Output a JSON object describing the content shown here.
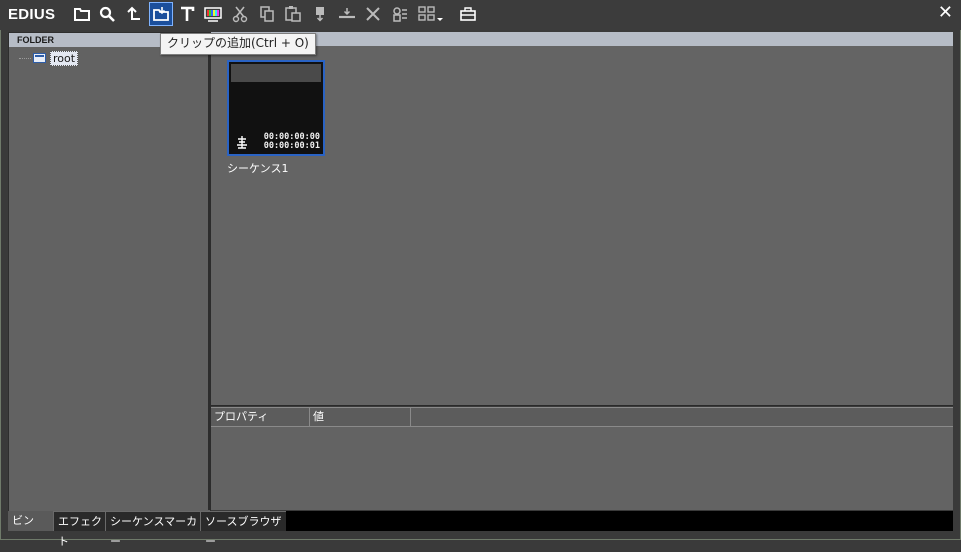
{
  "app": {
    "title": "EDIUS",
    "close_label": "✕"
  },
  "toolbar": {
    "tooltip": "クリップの追加(Ctrl + O)",
    "buttons": [
      "new-folder",
      "search",
      "up-level",
      "add-clip",
      "title",
      "color-bar",
      "cut",
      "copy",
      "paste",
      "add-to-timeline",
      "insert",
      "delete",
      "properties",
      "view-mode",
      "bin-menu"
    ],
    "active_button": "add-clip",
    "accent_color": "#1b4f9c"
  },
  "folder": {
    "header": "FOLDER",
    "tree": [
      {
        "label": "root",
        "icon": "folder-icon"
      }
    ]
  },
  "clips": [
    {
      "name": "シーケンス1",
      "timecode_in": "00:00:00:00",
      "timecode_out": "00:00:00:01",
      "icon": "sequence-icon"
    }
  ],
  "properties": {
    "columns": [
      "プロパティ",
      "値"
    ]
  },
  "tabs": [
    {
      "label": "ビン",
      "active": true
    },
    {
      "label": "エフェクト",
      "active": false
    },
    {
      "label": "シーケンスマーカー",
      "active": false
    },
    {
      "label": "ソースブラウザー",
      "active": false
    }
  ]
}
